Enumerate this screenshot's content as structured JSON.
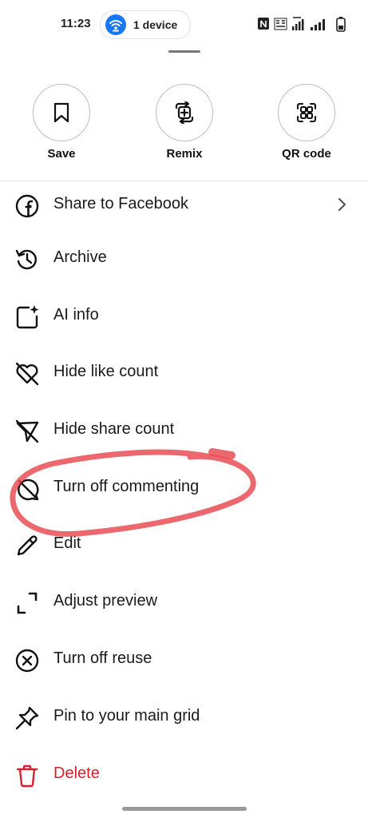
{
  "status_bar": {
    "time": "11:23",
    "device_pill": "1 device",
    "indicators": [
      "nfc-icon",
      "volte-icon",
      "4g-signal-icon",
      "signal-icon",
      "battery-icon"
    ]
  },
  "actions": [
    {
      "label": "Save",
      "icon": "bookmark-icon"
    },
    {
      "label": "Remix",
      "icon": "remix-icon"
    },
    {
      "label": "QR code",
      "icon": "qr-code-icon"
    }
  ],
  "menu": [
    {
      "label": "Share to Facebook",
      "icon": "facebook-icon",
      "has_chevron": true
    },
    {
      "label": "Archive",
      "icon": "archive-icon"
    },
    {
      "label": "AI info",
      "icon": "ai-info-icon"
    },
    {
      "label": "Hide like count",
      "icon": "heart-off-icon"
    },
    {
      "label": "Hide share count",
      "icon": "send-off-icon"
    },
    {
      "label": "Turn off commenting",
      "icon": "comment-off-icon",
      "annotated": true
    },
    {
      "label": "Edit",
      "icon": "pencil-icon"
    },
    {
      "label": "Adjust preview",
      "icon": "crop-icon"
    },
    {
      "label": "Turn off reuse",
      "icon": "circle-x-icon"
    },
    {
      "label": "Pin to your main grid",
      "icon": "pin-icon"
    },
    {
      "label": "Delete",
      "icon": "trash-icon",
      "danger": true
    }
  ],
  "colors": {
    "danger": "#d6202f",
    "pill_accent": "#1877f2",
    "annotation": "#e8474f"
  }
}
